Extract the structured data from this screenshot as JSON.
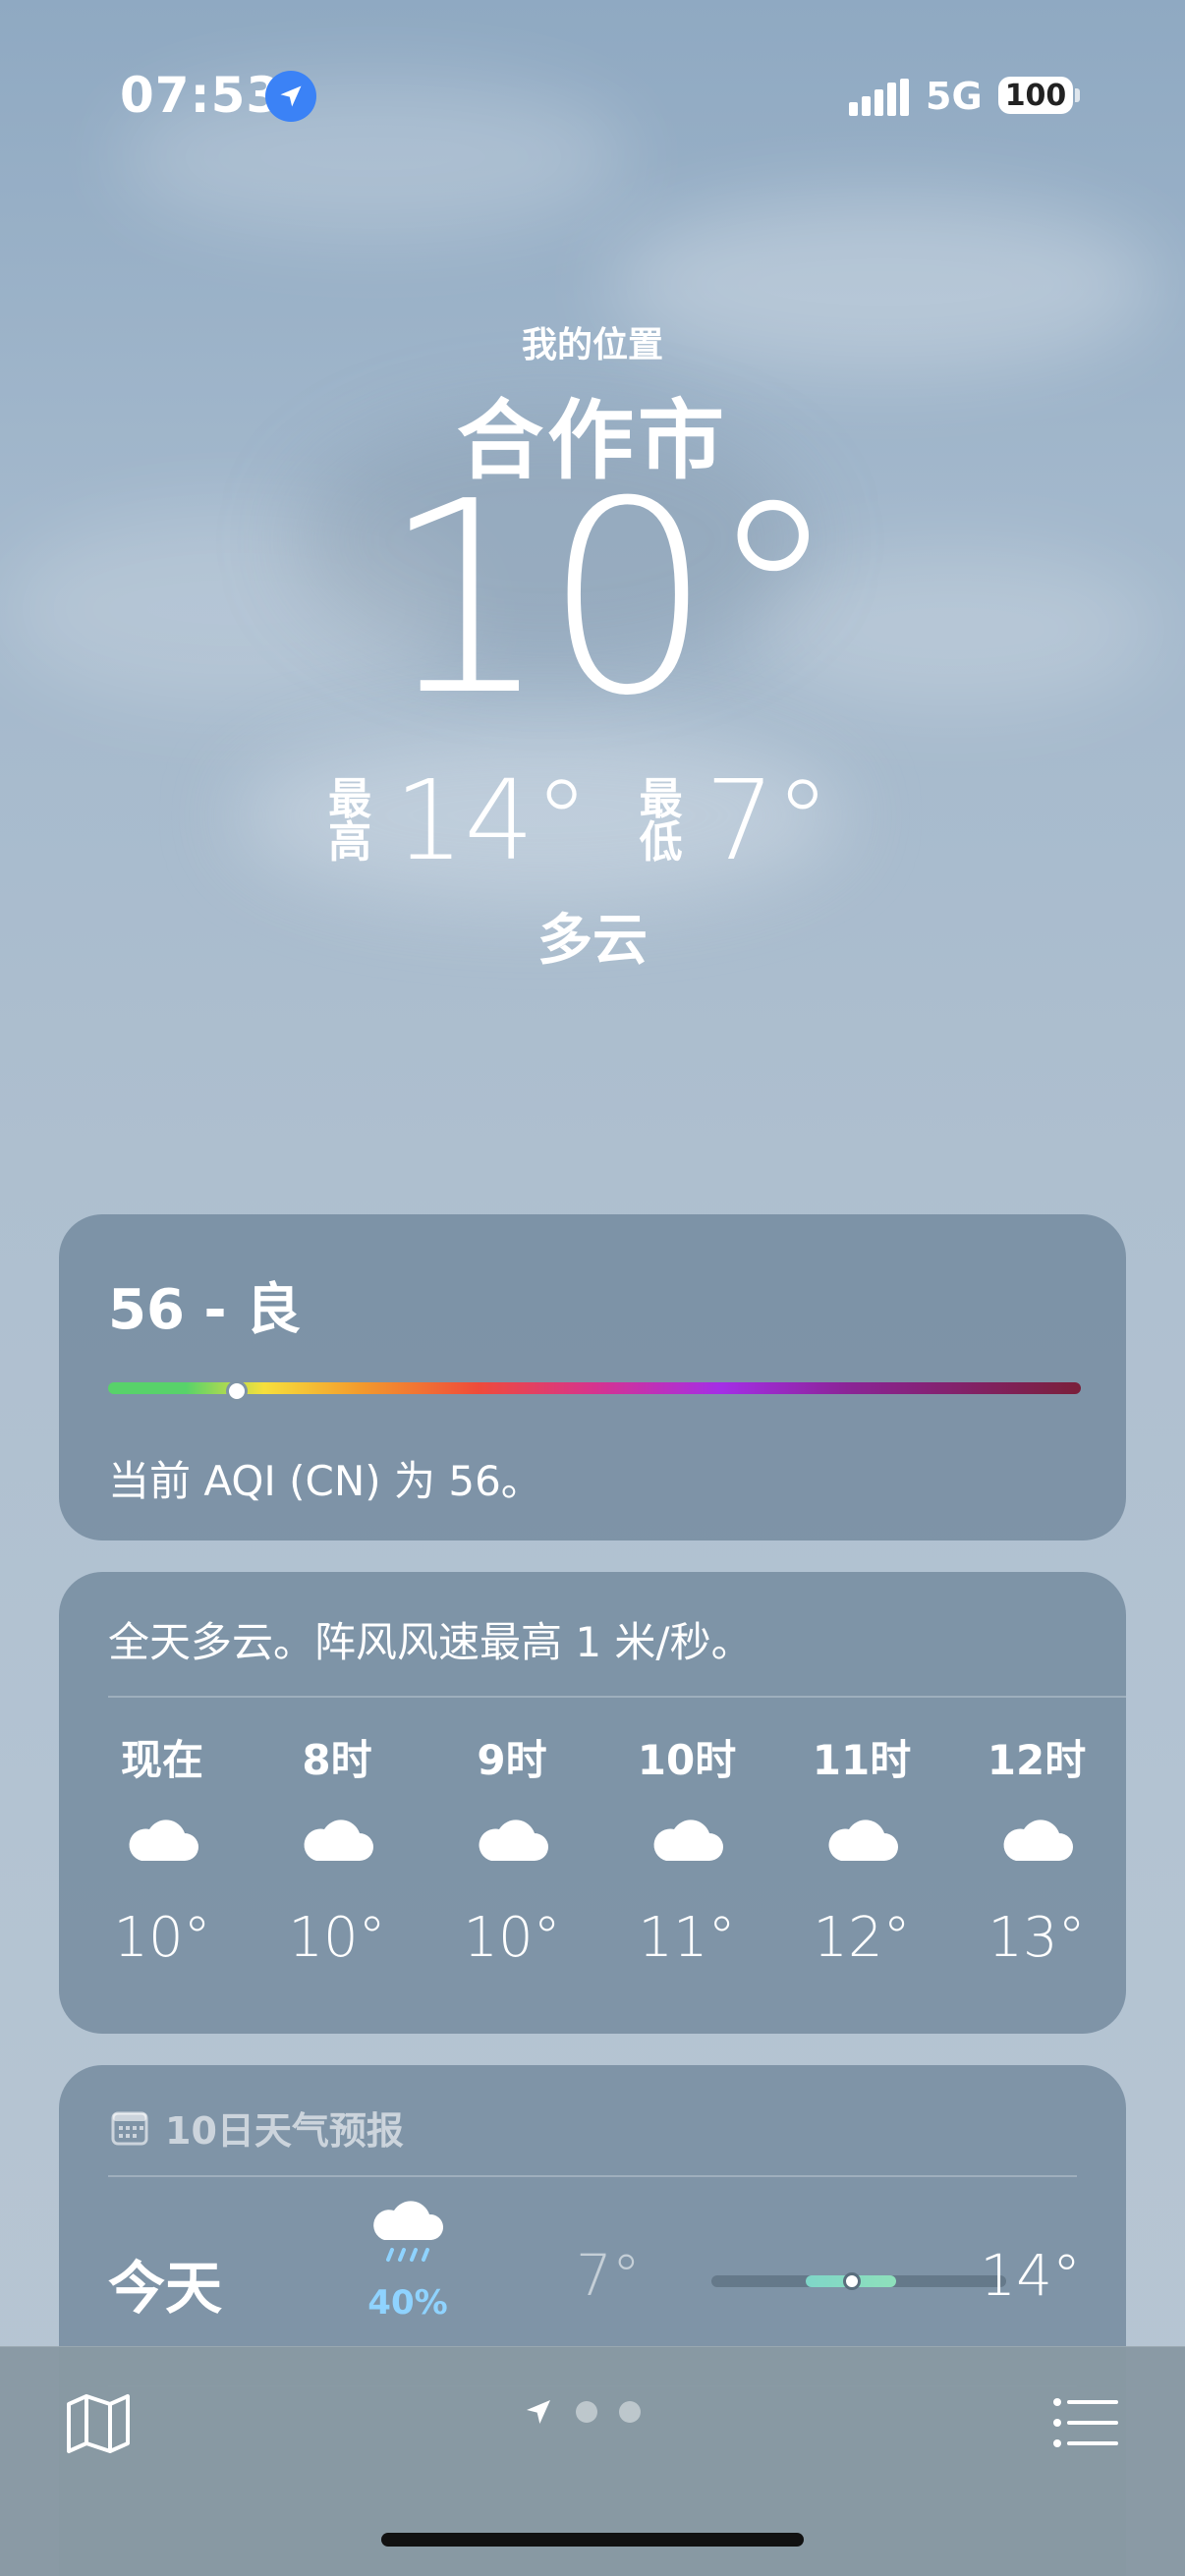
{
  "status_bar": {
    "time": "07:53",
    "network": "5G",
    "battery": "100"
  },
  "location": {
    "subtitle": "我的位置",
    "city": "合作市",
    "temperature": "10°",
    "high_label": "最高",
    "high": "14°",
    "low_label": "最低",
    "low": "7°",
    "condition": "多云"
  },
  "aqi": {
    "value_text": "56 - 良",
    "description": "当前 AQI (CN) 为 56。",
    "level": 56
  },
  "hourly": {
    "summary": "全天多云。阵风风速最高 1 米/秒。",
    "items": [
      {
        "label": "现在",
        "icon": "cloud-icon",
        "temp": "10°"
      },
      {
        "label": "8时",
        "icon": "cloud-icon",
        "temp": "10°"
      },
      {
        "label": "9时",
        "icon": "cloud-icon",
        "temp": "10°"
      },
      {
        "label": "10时",
        "icon": "cloud-icon",
        "temp": "11°"
      },
      {
        "label": "11时",
        "icon": "cloud-icon",
        "temp": "12°"
      },
      {
        "label": "12时",
        "icon": "cloud-icon",
        "temp": "13°"
      }
    ]
  },
  "daily": {
    "header": "10日天气预报",
    "days": [
      {
        "name": "今天",
        "icon": "cloud-rain-icon",
        "precip": "40%",
        "low": "7°",
        "high": "14°"
      }
    ]
  },
  "toolbar": {
    "map_icon": "map-icon",
    "location_icon": "location-arrow-icon",
    "list_icon": "list-icon",
    "pages": 3
  },
  "colors": {
    "precip_text": "#8fd3ff",
    "location_badge": "#3b82f6"
  }
}
